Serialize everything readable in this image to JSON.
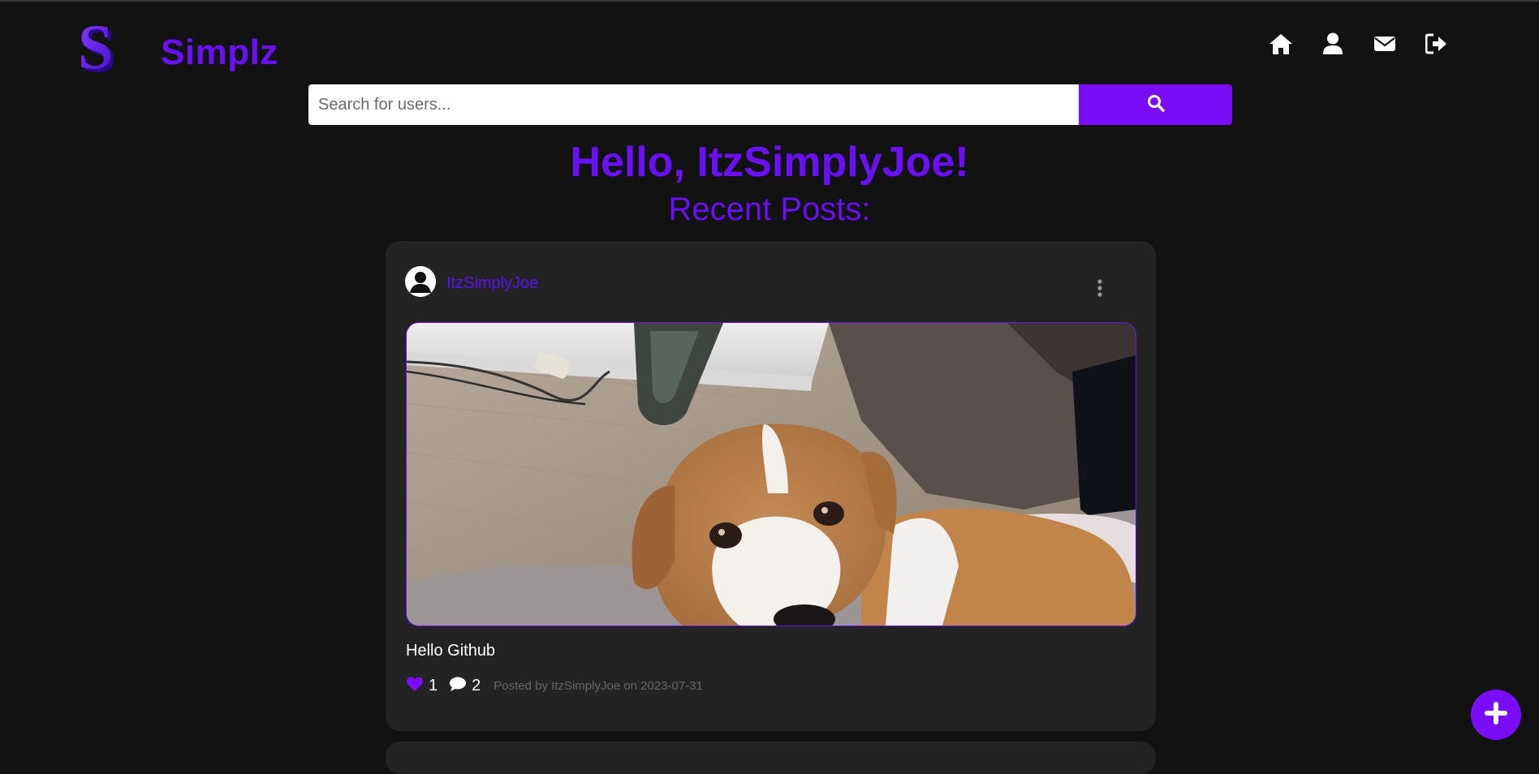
{
  "app": {
    "brand": "Simplz",
    "logo_letter": "S"
  },
  "nav": {
    "icons": [
      "home-icon",
      "user-icon",
      "envelope-icon",
      "sign-out-icon"
    ]
  },
  "search": {
    "placeholder": "Search for users...",
    "value": ""
  },
  "greeting": "Hello, ItzSimplyJoe!",
  "section_title": "Recent Posts:",
  "posts": [
    {
      "author": "ItzSimplyJoe",
      "title": "Hello Github",
      "likes": "1",
      "comments": "2",
      "meta": "Posted by ItzSimplyJoe on 2023-07-31"
    }
  ],
  "colors": {
    "accent": "#7b0cf7",
    "brand_text": "#6a10f5",
    "background": "#121212",
    "card": "#232323"
  }
}
